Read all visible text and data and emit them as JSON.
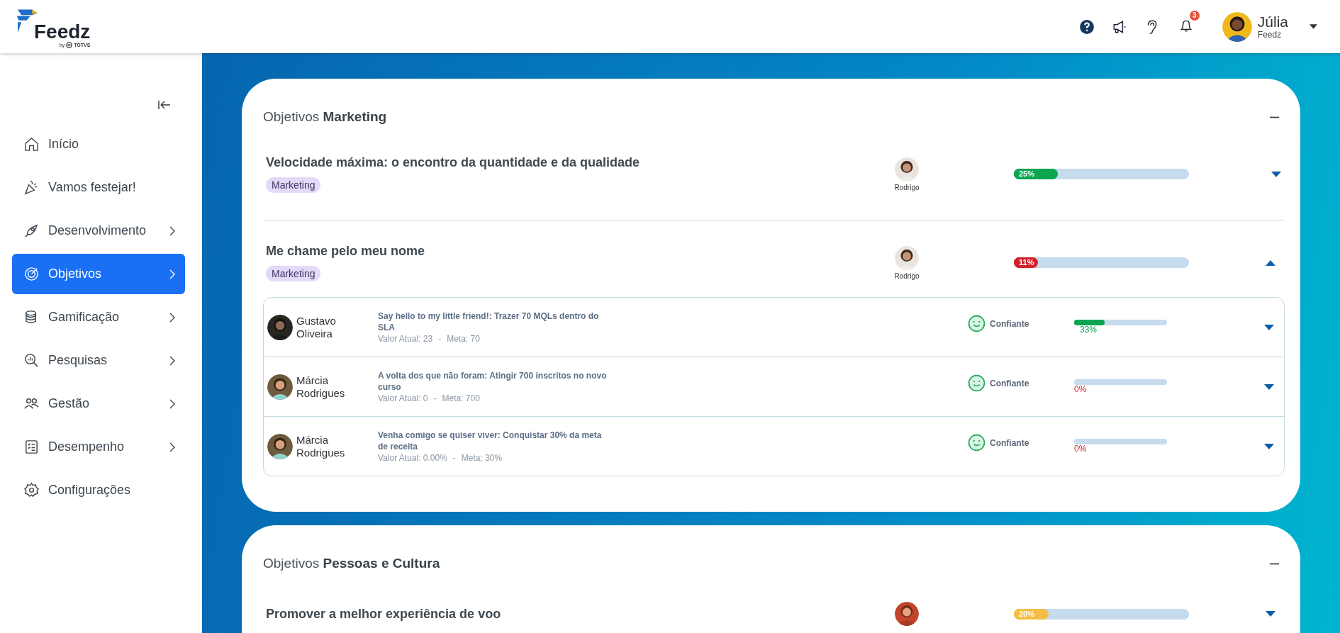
{
  "header": {
    "logo": {
      "name": "Feedz",
      "by": "by",
      "brand": "TOTVS"
    },
    "notification_count": "3",
    "user": {
      "name": "Júlia",
      "company": "Feedz"
    }
  },
  "sidebar": {
    "items": [
      {
        "label": "Início",
        "selected": false,
        "expandable": false
      },
      {
        "label": "Vamos festejar!",
        "selected": false,
        "expandable": false
      },
      {
        "label": "Desenvolvimento",
        "selected": false,
        "expandable": true
      },
      {
        "label": "Objetivos",
        "selected": true,
        "expandable": true
      },
      {
        "label": "Gamificação",
        "selected": false,
        "expandable": true
      },
      {
        "label": "Pesquisas",
        "selected": false,
        "expandable": true
      },
      {
        "label": "Gestão",
        "selected": false,
        "expandable": true
      },
      {
        "label": "Desempenho",
        "selected": false,
        "expandable": true
      },
      {
        "label": "Configurações",
        "selected": false,
        "expandable": false
      }
    ]
  },
  "sections": [
    {
      "prefix": "Objetivos",
      "name": "Marketing",
      "expanded": true,
      "objectives": [
        {
          "title": "Velocidade máxima: o encontro da quantidade e da qualidade",
          "tag": "Marketing",
          "owner": "Rodrigo",
          "level": 0.25,
          "percent": "25%",
          "color": "#0aa54f",
          "expanded": false
        },
        {
          "title": "Me chame pelo meu nome",
          "tag": "Marketing",
          "owner": "Rodrigo",
          "level": 0.11,
          "percent": "11%",
          "color": "#d3222a",
          "expanded": true,
          "key_results": [
            {
              "person": [
                "Gustavo",
                "Oliveira"
              ],
              "title": "Say hello to my little friend!: Trazer 70 MQLs dentro do SLA",
              "current": "Valor Atual: 23",
              "separator": "-",
              "target": "Meta: 70",
              "confidence": "Confiante",
              "level": 0.33,
              "percent": "33%",
              "color": "#0aa54f"
            },
            {
              "person": [
                "Márcia",
                "Rodrigues"
              ],
              "title": "A volta dos que não foram: Atingir 700 inscritos no novo curso",
              "current": "Valor Atual: 0",
              "separator": "-",
              "target": "Meta: 700",
              "confidence": "Confiante",
              "level": 0,
              "percent": "0%",
              "color": "#d3222a"
            },
            {
              "person": [
                "Márcia",
                "Rodrigues"
              ],
              "title": "Venha comigo se quiser viver: Conquistar 30% da meta de receita",
              "current": "Valor Atual: 0.00%",
              "separator": "-",
              "target": "Meta: 30%",
              "confidence": "Confiante",
              "level": 0,
              "percent": "0%",
              "color": "#d3222a"
            }
          ]
        }
      ]
    },
    {
      "prefix": "Objetivos",
      "name": "Pessoas e Cultura",
      "expanded": true,
      "objectives": [
        {
          "title": "Promover a melhor experiência de voo",
          "level": 0.2,
          "percent": "20%",
          "color": "#f5bd45",
          "expanded": false
        }
      ]
    }
  ]
}
